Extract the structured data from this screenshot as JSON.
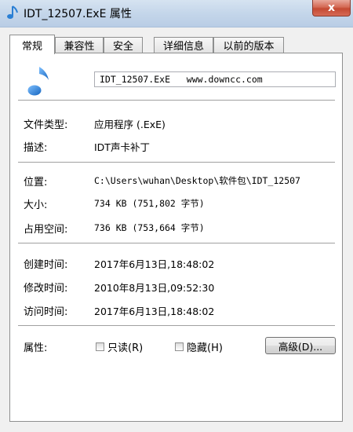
{
  "window": {
    "title": "IDT_12507.ExE 属性",
    "close_label": "x"
  },
  "tabs": [
    {
      "label": "常规",
      "active": true
    },
    {
      "label": "兼容性",
      "active": false
    },
    {
      "label": "安全",
      "active": false
    },
    {
      "label": "详细信息",
      "active": false
    },
    {
      "label": "以前的版本",
      "active": false
    }
  ],
  "general": {
    "file_name": "IDT_12507.ExE   www.downcc.com",
    "file_type_label": "文件类型:",
    "file_type_value": "应用程序 (.ExE)",
    "description_label": "描述:",
    "description_value": "IDT声卡补丁",
    "location_label": "位置:",
    "location_value": "C:\\Users\\wuhan\\Desktop\\软件包\\IDT_12507",
    "size_label": "大小:",
    "size_value": "734 KB (751,802 字节)",
    "size_on_disk_label": "占用空间:",
    "size_on_disk_value": "736 KB (753,664 字节)",
    "created_label": "创建时间:",
    "created_value": "2017年6月13日,18:48:02",
    "modified_label": "修改时间:",
    "modified_value": "2010年8月13日,09:52:30",
    "accessed_label": "访问时间:",
    "accessed_value": "2017年6月13日,18:48:02",
    "attributes_label": "属性:",
    "readonly_label": "只读(R)",
    "readonly_checked": false,
    "hidden_label": "隐藏(H)",
    "hidden_checked": false,
    "advanced_label": "高级(D)..."
  },
  "colors": {
    "note_icon": "#2a7fd4",
    "close_button": "#c44a33"
  },
  "icons": {
    "title": "music-note-icon",
    "file": "music-note-icon"
  }
}
